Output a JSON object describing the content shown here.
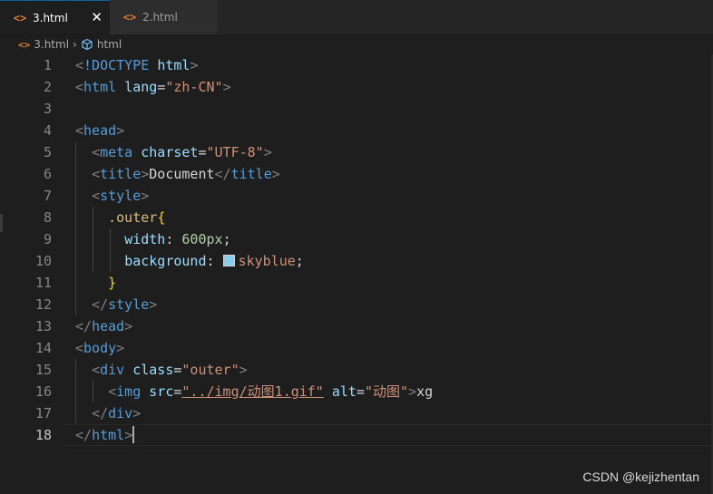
{
  "tabs": [
    {
      "label": "3.html",
      "icon": "html-file-icon",
      "active": true
    },
    {
      "label": "2.html",
      "icon": "html-file-icon",
      "active": false
    }
  ],
  "breadcrumb": {
    "file": "3.html",
    "element": "html"
  },
  "icons": {
    "tab_file": "<>",
    "close": "✕",
    "chevron": "›"
  },
  "lines": [
    {
      "n": "1",
      "tokens": [
        {
          "c": "t-punct",
          "t": "<"
        },
        {
          "c": "t-tag",
          "t": "!DOCTYPE"
        },
        {
          "c": "t-text",
          "t": " "
        },
        {
          "c": "t-attr",
          "t": "html"
        },
        {
          "c": "t-punct",
          "t": ">"
        }
      ]
    },
    {
      "n": "2",
      "tokens": [
        {
          "c": "t-punct",
          "t": "<"
        },
        {
          "c": "t-tag",
          "t": "html"
        },
        {
          "c": "t-text",
          "t": " "
        },
        {
          "c": "t-attr",
          "t": "lang"
        },
        {
          "c": "t-text",
          "t": "="
        },
        {
          "c": "t-val",
          "t": "\"zh-CN\""
        },
        {
          "c": "t-punct",
          "t": ">"
        }
      ]
    },
    {
      "n": "3",
      "tokens": []
    },
    {
      "n": "4",
      "tokens": [
        {
          "c": "t-punct",
          "t": "<"
        },
        {
          "c": "t-tag",
          "t": "head"
        },
        {
          "c": "t-punct",
          "t": ">"
        }
      ]
    },
    {
      "n": "5",
      "tokens": [
        {
          "c": "t-text",
          "t": "  "
        },
        {
          "c": "t-punct",
          "t": "<"
        },
        {
          "c": "t-tag",
          "t": "meta"
        },
        {
          "c": "t-text",
          "t": " "
        },
        {
          "c": "t-attr",
          "t": "charset"
        },
        {
          "c": "t-text",
          "t": "="
        },
        {
          "c": "t-val",
          "t": "\"UTF-8\""
        },
        {
          "c": "t-punct",
          "t": ">"
        }
      ]
    },
    {
      "n": "6",
      "tokens": [
        {
          "c": "t-text",
          "t": "  "
        },
        {
          "c": "t-punct",
          "t": "<"
        },
        {
          "c": "t-tag",
          "t": "title"
        },
        {
          "c": "t-punct",
          "t": ">"
        },
        {
          "c": "t-text",
          "t": "Document"
        },
        {
          "c": "t-punct",
          "t": "</"
        },
        {
          "c": "t-tag",
          "t": "title"
        },
        {
          "c": "t-punct",
          "t": ">"
        }
      ]
    },
    {
      "n": "7",
      "tokens": [
        {
          "c": "t-text",
          "t": "  "
        },
        {
          "c": "t-punct",
          "t": "<"
        },
        {
          "c": "t-tag",
          "t": "style"
        },
        {
          "c": "t-punct",
          "t": ">"
        }
      ]
    },
    {
      "n": "8",
      "tokens": [
        {
          "c": "t-text",
          "t": "    "
        },
        {
          "c": "t-sel",
          "t": ".outer"
        },
        {
          "c": "t-brace",
          "t": "{"
        }
      ]
    },
    {
      "n": "9",
      "tokens": [
        {
          "c": "t-text",
          "t": "      "
        },
        {
          "c": "t-prop",
          "t": "width"
        },
        {
          "c": "t-text",
          "t": ": "
        },
        {
          "c": "t-num",
          "t": "600px"
        },
        {
          "c": "t-text",
          "t": ";"
        }
      ]
    },
    {
      "n": "10",
      "tokens": [
        {
          "c": "t-text",
          "t": "      "
        },
        {
          "c": "t-prop",
          "t": "background"
        },
        {
          "c": "t-text",
          "t": ": "
        },
        {
          "c": "swatch",
          "t": ""
        },
        {
          "c": "t-val",
          "t": "skyblue"
        },
        {
          "c": "t-text",
          "t": ";"
        }
      ]
    },
    {
      "n": "11",
      "tokens": [
        {
          "c": "t-text",
          "t": "    "
        },
        {
          "c": "t-brace",
          "t": "}"
        }
      ]
    },
    {
      "n": "12",
      "tokens": [
        {
          "c": "t-text",
          "t": "  "
        },
        {
          "c": "t-punct",
          "t": "</"
        },
        {
          "c": "t-tag",
          "t": "style"
        },
        {
          "c": "t-punct",
          "t": ">"
        }
      ]
    },
    {
      "n": "13",
      "tokens": [
        {
          "c": "t-punct",
          "t": "</"
        },
        {
          "c": "t-tag",
          "t": "head"
        },
        {
          "c": "t-punct",
          "t": ">"
        }
      ]
    },
    {
      "n": "14",
      "tokens": [
        {
          "c": "t-punct",
          "t": "<"
        },
        {
          "c": "t-tag",
          "t": "body"
        },
        {
          "c": "t-punct",
          "t": ">"
        }
      ]
    },
    {
      "n": "15",
      "tokens": [
        {
          "c": "t-text",
          "t": "  "
        },
        {
          "c": "t-punct",
          "t": "<"
        },
        {
          "c": "t-tag",
          "t": "div"
        },
        {
          "c": "t-text",
          "t": " "
        },
        {
          "c": "t-attr",
          "t": "class"
        },
        {
          "c": "t-text",
          "t": "="
        },
        {
          "c": "t-val",
          "t": "\"outer\""
        },
        {
          "c": "t-punct",
          "t": ">"
        }
      ]
    },
    {
      "n": "16",
      "tokens": [
        {
          "c": "t-text",
          "t": "    "
        },
        {
          "c": "t-punct",
          "t": "<"
        },
        {
          "c": "t-tag",
          "t": "img"
        },
        {
          "c": "t-text",
          "t": " "
        },
        {
          "c": "t-attr",
          "t": "src"
        },
        {
          "c": "t-text",
          "t": "="
        },
        {
          "c": "t-val t-link",
          "t": "\"../img/动图1.gif\""
        },
        {
          "c": "t-text",
          "t": " "
        },
        {
          "c": "t-attr",
          "t": "alt"
        },
        {
          "c": "t-text",
          "t": "="
        },
        {
          "c": "t-val",
          "t": "\"动图\""
        },
        {
          "c": "t-punct",
          "t": ">"
        },
        {
          "c": "t-text",
          "t": "xg"
        }
      ]
    },
    {
      "n": "17",
      "tokens": [
        {
          "c": "t-text",
          "t": "  "
        },
        {
          "c": "t-punct",
          "t": "</"
        },
        {
          "c": "t-tag",
          "t": "div"
        },
        {
          "c": "t-punct",
          "t": ">"
        }
      ]
    },
    {
      "n": "18",
      "tokens": [
        {
          "c": "t-punct",
          "t": "</"
        },
        {
          "c": "t-tag",
          "t": "html"
        },
        {
          "c": "t-punct",
          "t": ">"
        },
        {
          "c": "cursor",
          "t": ""
        }
      ]
    }
  ],
  "current_line": "18",
  "watermark": "CSDN @kejizhentan",
  "colors": {
    "background": "#1e1e1e",
    "tag": "#569cd6",
    "attribute": "#9cdcfe",
    "string": "#ce9178",
    "selector": "#d7ba7d",
    "number": "#b5cea8",
    "file_icon": "#e37933",
    "swatch": "#87ceeb"
  }
}
